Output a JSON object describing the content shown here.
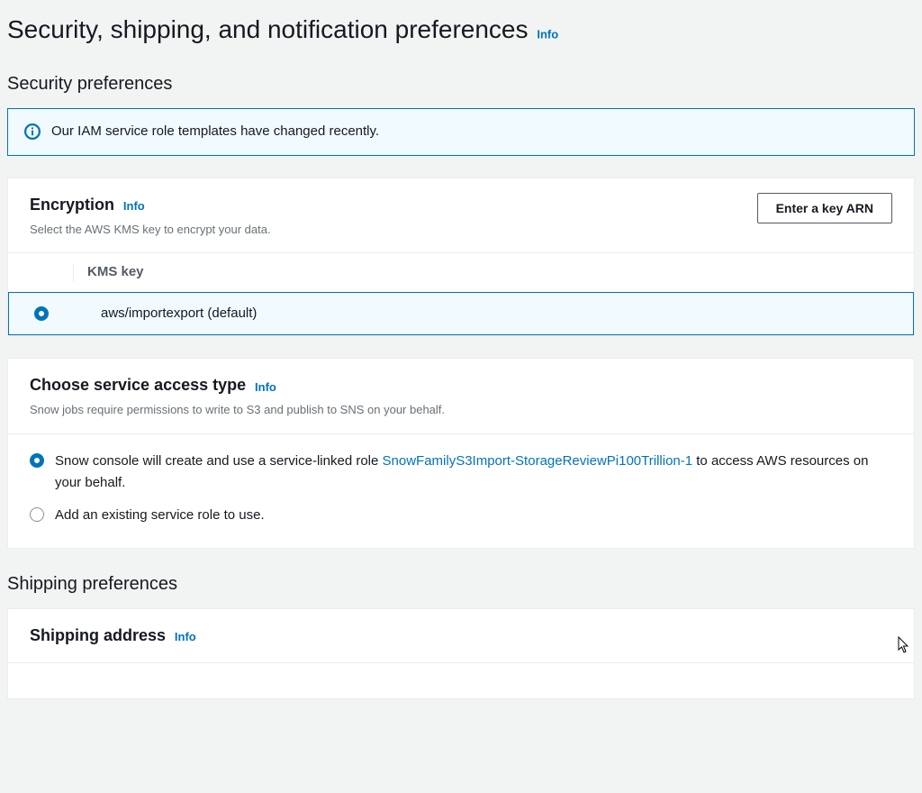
{
  "page": {
    "title": "Security, shipping, and notification preferences",
    "info": "Info"
  },
  "security": {
    "heading": "Security preferences",
    "alert": "Our IAM service role templates have changed recently.",
    "encryption": {
      "title": "Encryption",
      "info": "Info",
      "desc": "Select the AWS KMS key to encrypt your data.",
      "button": "Enter a key ARN",
      "table": {
        "header": "KMS key",
        "rows": [
          {
            "label": "aws/importexport (default)",
            "selected": true
          }
        ]
      }
    },
    "access": {
      "title": "Choose service access type",
      "info": "Info",
      "desc": "Snow jobs require permissions to write to S3 and publish to SNS on your behalf.",
      "options": [
        {
          "prefix": "Snow console will create and use a service-linked role ",
          "link": "SnowFamilyS3Import-StorageReviewPi100Trillion-1",
          "suffix": " to access AWS resources on your behalf.",
          "checked": true
        },
        {
          "prefix": "Add an existing service role to use.",
          "link": "",
          "suffix": "",
          "checked": false
        }
      ]
    }
  },
  "shipping": {
    "heading": "Shipping preferences",
    "address": {
      "title": "Shipping address",
      "info": "Info"
    }
  }
}
